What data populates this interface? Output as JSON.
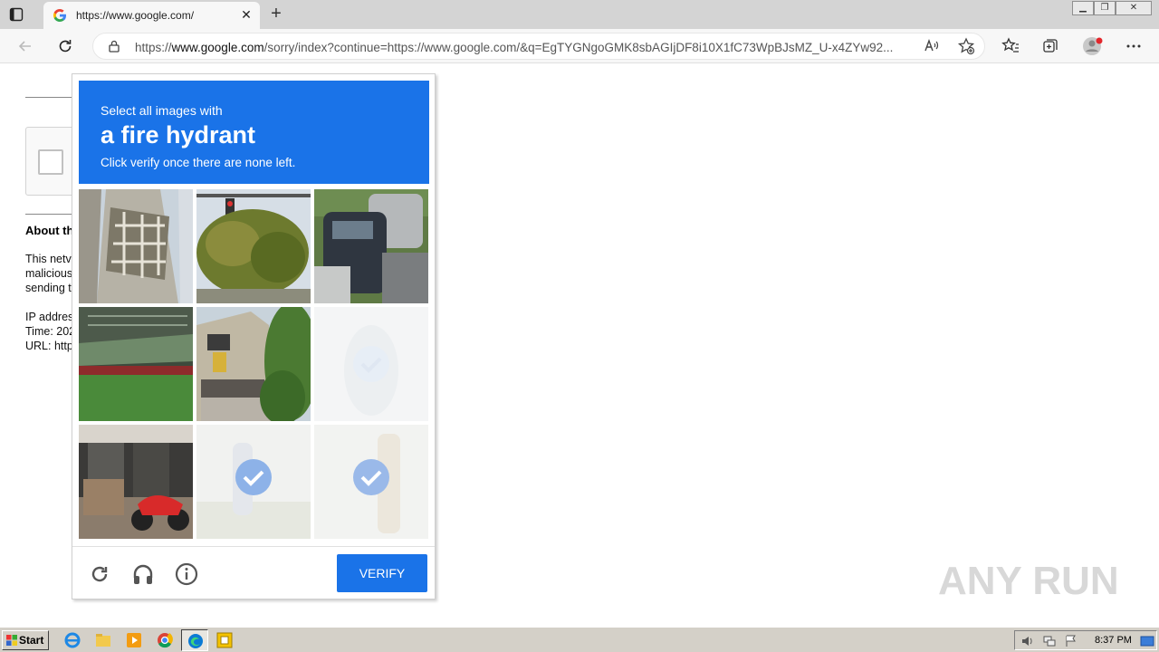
{
  "browser": {
    "tab_title": "https://www.google.com/",
    "tab_close": "✕",
    "new_tab": "+",
    "url_prefix": "https://",
    "url_domain": "www.google.com",
    "url_rest": "/sorry/index?continue=https://www.google.com/&q=EgTYGNgoGMK8sbAGIjDF8i10X1fC73WpBJsMZ_U-x4ZYw92...",
    "window_buttons": [
      "▁",
      "❐",
      "✕"
    ]
  },
  "background_page": {
    "about_heading": "About th",
    "lines": [
      "This netv",
      "malicious",
      "sending t",
      "IP addres",
      "Time: 202",
      "URL: http"
    ]
  },
  "captcha": {
    "instruction_line1": "Select all images with",
    "target_object": "a fire hydrant",
    "instruction_line3": "Click verify once there are none left.",
    "verify_label": "VERIFY",
    "tiles": [
      {
        "scene": "fire-escape building",
        "selected": false,
        "loading": false
      },
      {
        "scene": "tree with traffic light",
        "selected": false,
        "loading": false
      },
      {
        "scene": "parked cars",
        "selected": false,
        "loading": false
      },
      {
        "scene": "green storefront awning",
        "selected": false,
        "loading": false
      },
      {
        "scene": "house with garage",
        "selected": false,
        "loading": false
      },
      {
        "scene": "faded hydrant",
        "selected": true,
        "loading": true
      },
      {
        "scene": "motorcycle by shop",
        "selected": false,
        "loading": false
      },
      {
        "scene": "faded hydrant",
        "selected": true,
        "loading": true
      },
      {
        "scene": "faded hydrant",
        "selected": true,
        "loading": true
      }
    ]
  },
  "watermark": "ANY RUN",
  "taskbar": {
    "start_label": "Start",
    "clock": "8:37 PM"
  },
  "colors": {
    "accent": "#1a73e8",
    "taskbar": "#d4d0c8",
    "tab_strip": "#d4d4d4"
  }
}
